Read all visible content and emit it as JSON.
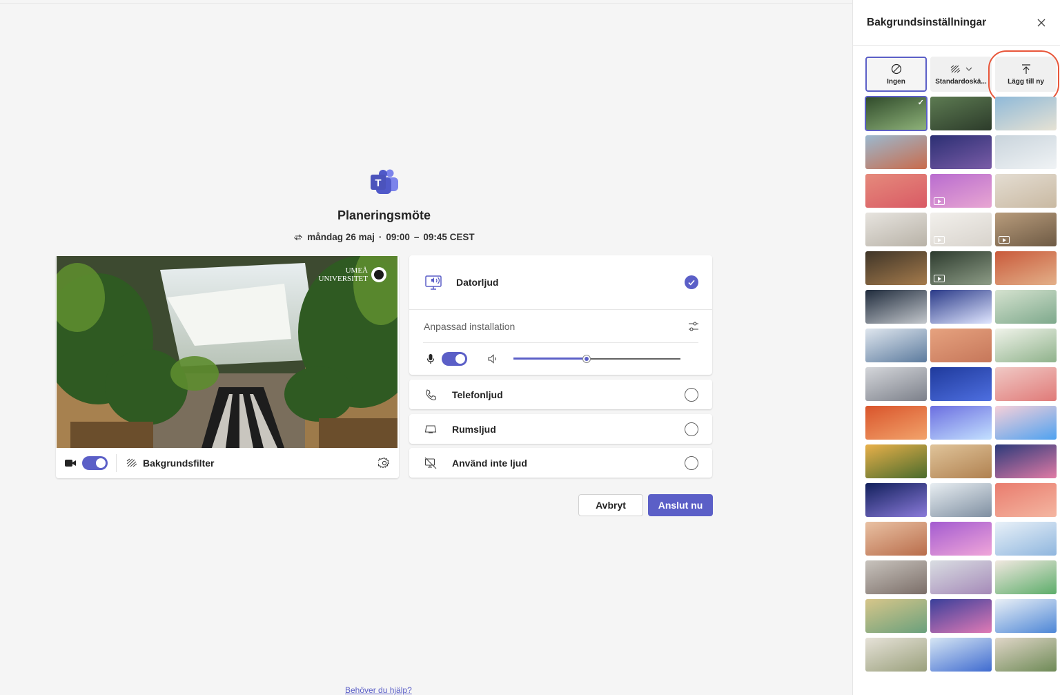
{
  "meeting": {
    "title": "Planeringsmöte",
    "date": "måndag 26 maj",
    "start": "09:00",
    "dash": "–",
    "end": "09:45 CEST"
  },
  "video": {
    "watermark_line1": "UMEÅ",
    "watermark_line2": "UNIVERSITET",
    "camera_on": true,
    "background_filter_label": "Bakgrundsfilter"
  },
  "audio": {
    "computer_audio": "Datorljud",
    "custom_setup": "Anpassad installation",
    "mic_on": true,
    "speaker_volume": 0.44,
    "phone_audio": "Telefonljud",
    "room_audio": "Rumsljud",
    "no_audio": "Använd inte ljud",
    "selected": "computer_audio"
  },
  "buttons": {
    "cancel": "Avbryt",
    "join": "Anslut nu"
  },
  "help_link": "Behöver du hjälp?",
  "panel": {
    "title": "Bakgrundsinställningar",
    "options": {
      "none": "Ingen",
      "standard": "Standardoskä...",
      "add_new": "Lägg till ny"
    }
  },
  "colors": {
    "accent": "#5b5fc7",
    "highlight": "#e8563a"
  }
}
